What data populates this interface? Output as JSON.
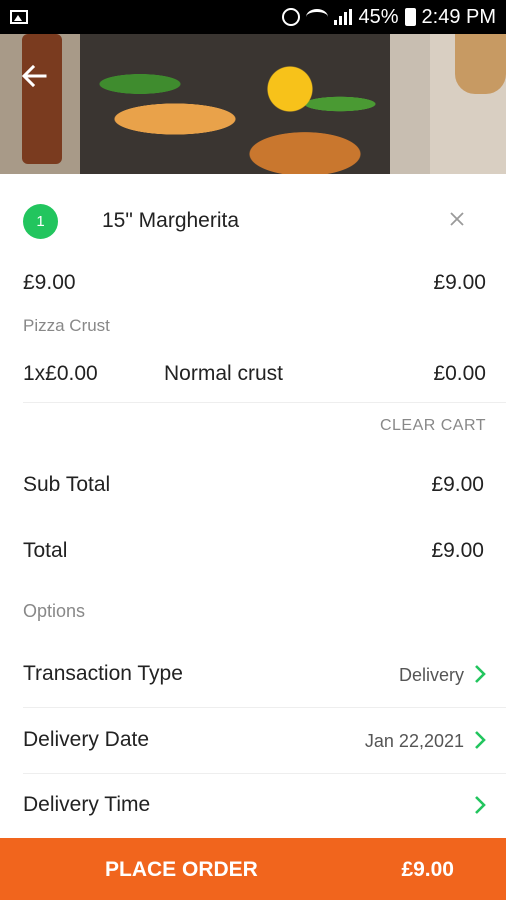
{
  "status_bar": {
    "battery": "45%",
    "time": "2:49 PM"
  },
  "cart_item": {
    "quantity": "1",
    "name": "15\" Margherita",
    "unit_price": "£9.00",
    "line_total": "£9.00",
    "modifier_group": "Pizza Crust",
    "modifier_qty_price": "1x£0.00",
    "modifier_name": "Normal crust",
    "modifier_total": "£0.00"
  },
  "clear_cart_label": "CLEAR CART",
  "summary": {
    "subtotal_label": "Sub Total",
    "subtotal_value": "£9.00",
    "total_label": "Total",
    "total_value": "£9.00"
  },
  "options": {
    "heading": "Options",
    "rows": [
      {
        "label": "Transaction Type",
        "value": "Delivery"
      },
      {
        "label": "Delivery Date",
        "value": "Jan 22,2021"
      },
      {
        "label": "Delivery Time",
        "value": ""
      }
    ]
  },
  "place_order": {
    "label": "PLACE ORDER",
    "amount": "£9.00"
  },
  "colors": {
    "accent_green": "#22c55e",
    "order_orange": "#f1651d"
  }
}
